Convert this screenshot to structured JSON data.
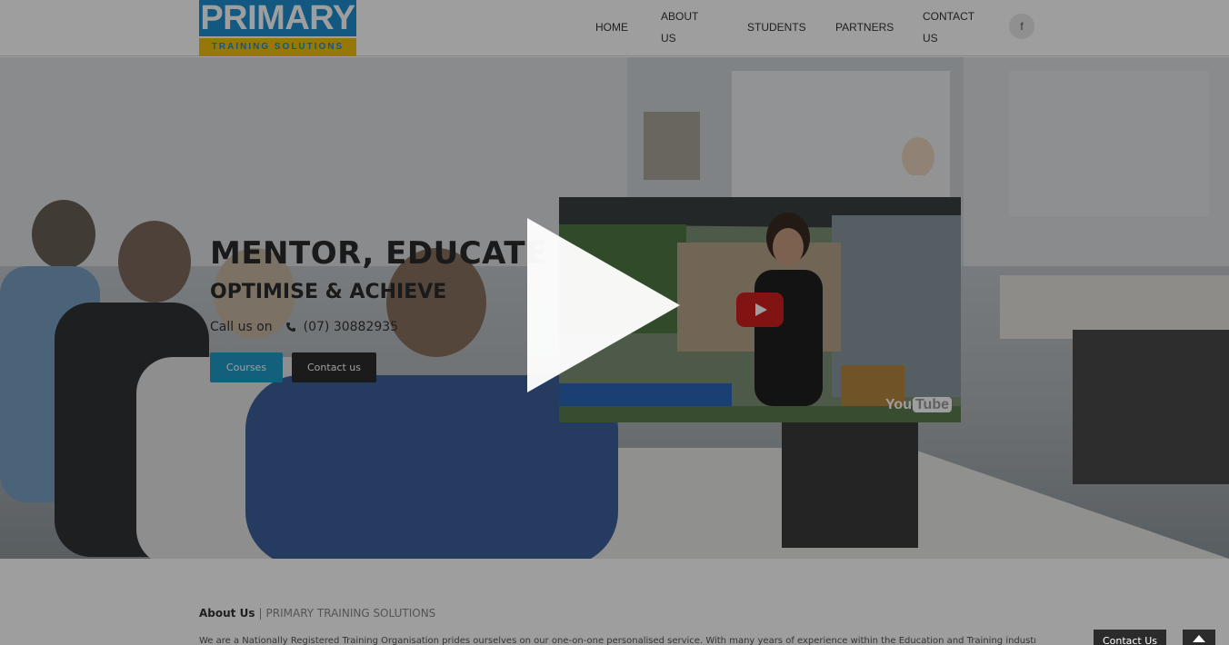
{
  "header": {
    "logo_main": "PRIMARY",
    "logo_sub": "TRAINING SOLUTIONS",
    "nav": [
      "HOME",
      "ABOUT US",
      "STUDENTS",
      "PARTNERS",
      "CONTACT US"
    ],
    "facebook_label": "f"
  },
  "hero": {
    "title": "MENTOR, EDUCATE",
    "subtitle": "OPTIMISE & ACHIEVE",
    "call_label": "Call us on",
    "phone": "(07) 30882935",
    "courses_button": "Courses",
    "contact_button": "Contact us"
  },
  "video": {
    "provider_logo_a": "You",
    "provider_logo_b": "Tube"
  },
  "about": {
    "title": "About Us",
    "separator": "|",
    "subtitle": "PRIMARY TRAINING SOLUTIONS",
    "paragraph": "We are a Nationally Registered Training Organisation prides ourselves on our one-on-one personalised service. With many years of experience within the Education and Training industry we..."
  },
  "floating": {
    "contact_label": "Contact Us"
  },
  "colors": {
    "brand_blue": "#1d8fd0",
    "brand_yellow": "#f2c20f",
    "button_teal": "#1e9bc9",
    "button_dark": "#2c2c2c"
  }
}
